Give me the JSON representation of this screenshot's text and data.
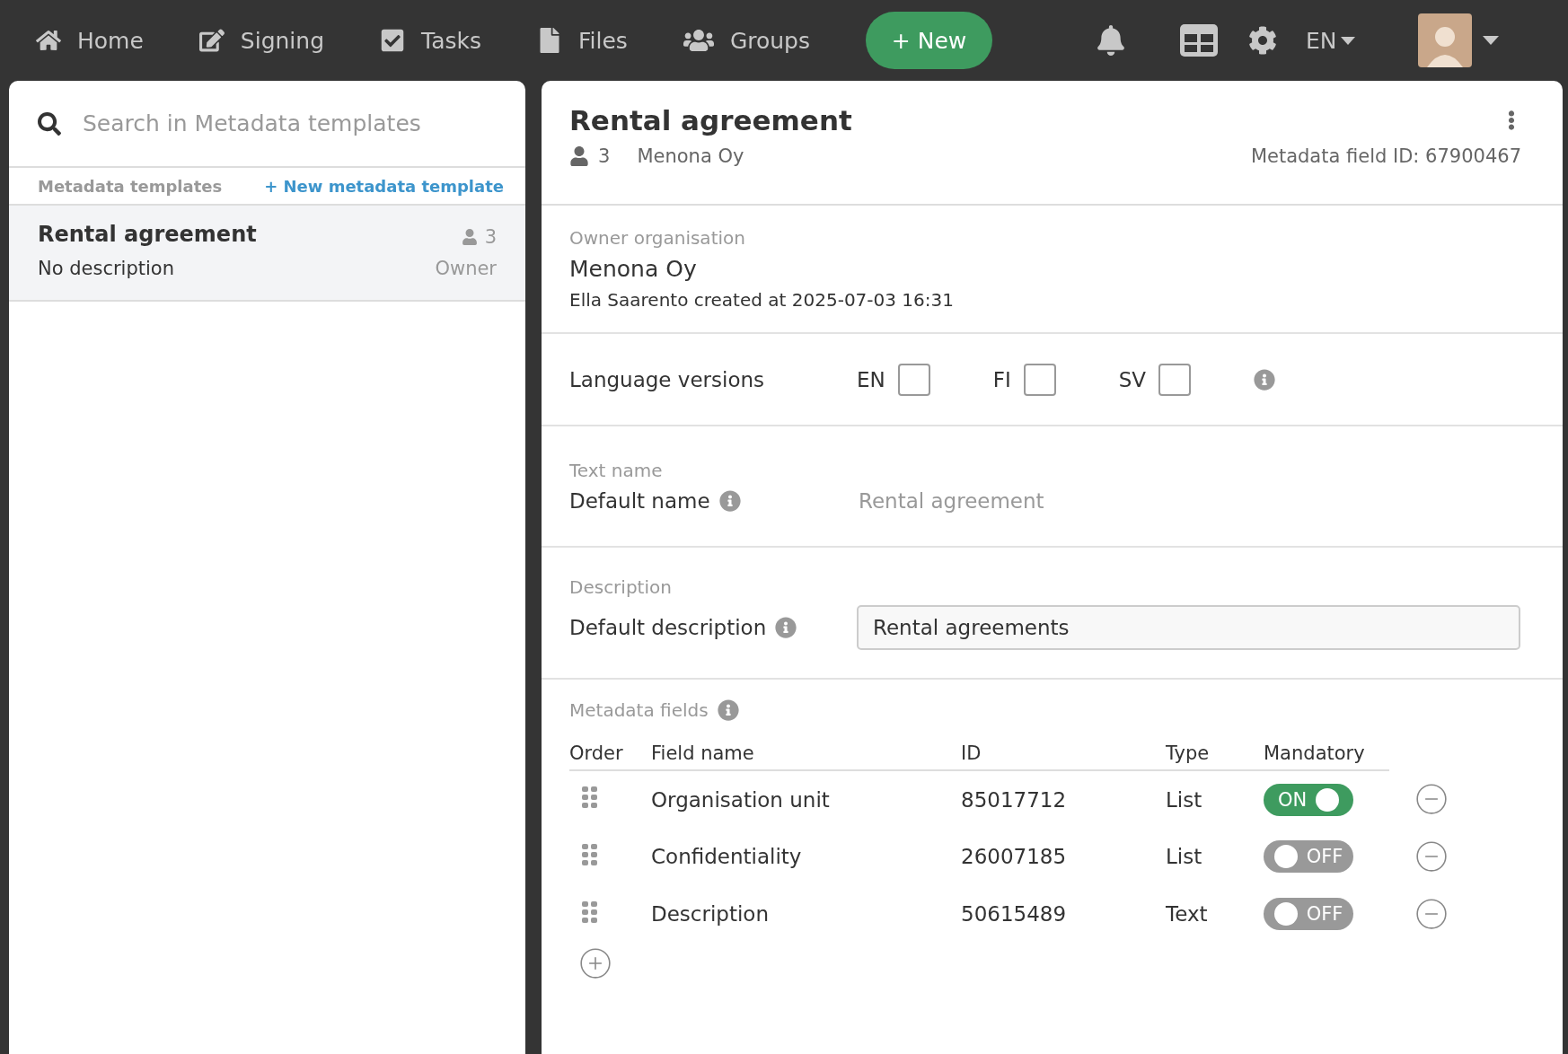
{
  "nav": {
    "items": [
      {
        "kind": "home",
        "label": "Home"
      },
      {
        "kind": "signing",
        "label": "Signing"
      },
      {
        "kind": "tasks",
        "label": "Tasks"
      },
      {
        "kind": "files",
        "label": "Files"
      },
      {
        "kind": "groups",
        "label": "Groups"
      }
    ],
    "new_button": "+ New",
    "language": "EN"
  },
  "sidebar": {
    "search": {
      "placeholder": "Search in Metadata templates"
    },
    "heading": "Metadata templates",
    "new_link": "+ New metadata template",
    "items": [
      {
        "title": "Rental agreement",
        "description": "No description",
        "count": "3",
        "role": "Owner",
        "selected": true
      }
    ]
  },
  "detail": {
    "title": "Rental agreement",
    "count": "3",
    "organisation": "Menona Oy",
    "field_id": "Metadata field ID: 67900467",
    "owner": {
      "label": "Owner organisation",
      "name": "Menona Oy",
      "created": "Ella Saarento created at 2025-07-03 16:31"
    },
    "language_versions": {
      "label": "Language versions",
      "options": [
        {
          "code": "EN",
          "checked": false
        },
        {
          "code": "FI",
          "checked": false
        },
        {
          "code": "SV",
          "checked": false
        }
      ]
    },
    "text_name": {
      "section": "Text name",
      "label": "Default name",
      "placeholder": "Rental agreement"
    },
    "description": {
      "section": "Description",
      "label": "Default description",
      "value": "Rental agreements"
    },
    "metadata_fields": {
      "section": "Metadata fields",
      "columns": [
        "Order",
        "Field name",
        "ID",
        "Type",
        "Mandatory"
      ],
      "rows": [
        {
          "name": "Organisation unit",
          "id": "85017712",
          "type": "List",
          "mandatory": true,
          "mandatory_label": "ON"
        },
        {
          "name": "Confidentiality",
          "id": "26007185",
          "type": "List",
          "mandatory": false,
          "mandatory_label": "OFF"
        },
        {
          "name": "Description",
          "id": "50615489",
          "type": "Text",
          "mandatory": false,
          "mandatory_label": "OFF"
        }
      ]
    }
  }
}
